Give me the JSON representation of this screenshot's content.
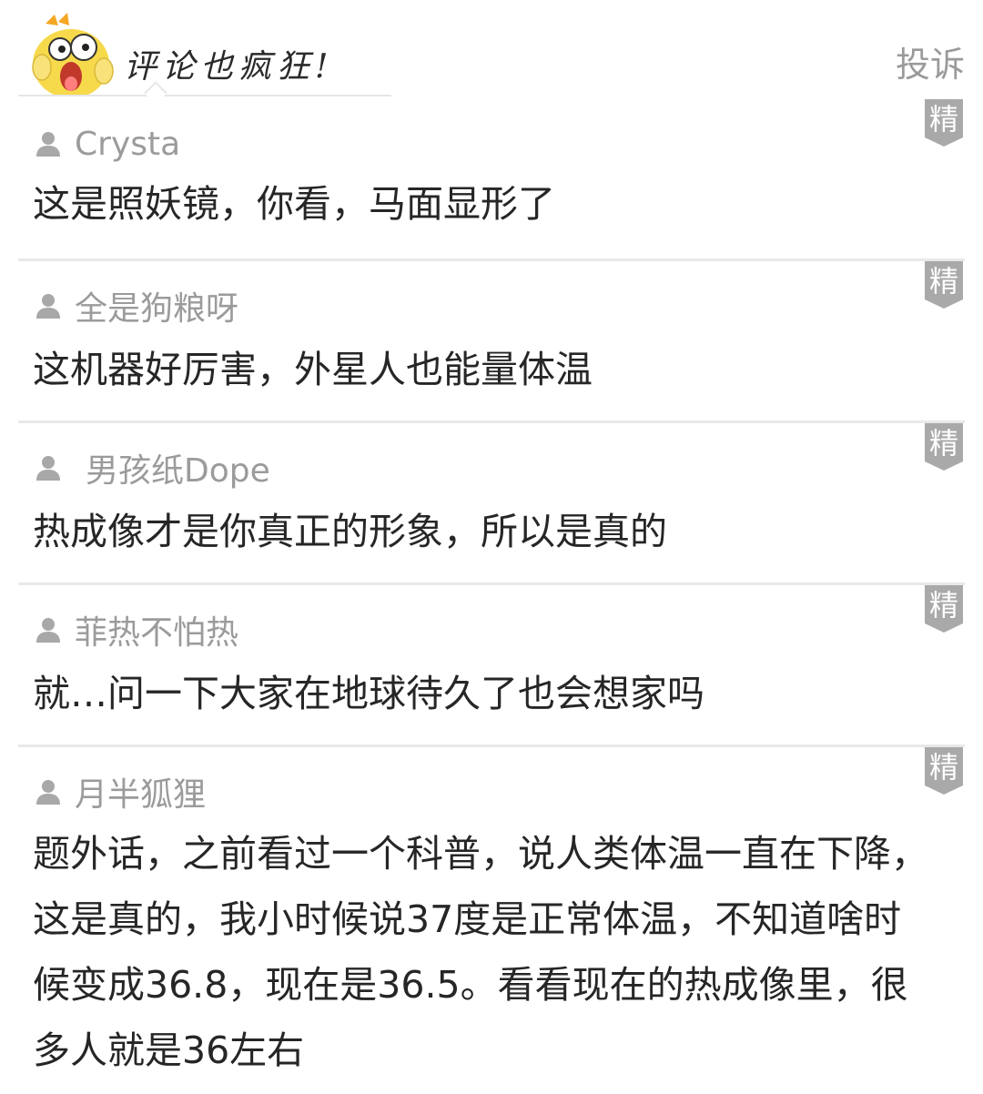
{
  "header": {
    "title": "评论也疯狂!",
    "report_label": "投诉"
  },
  "badge_label": "精",
  "comments": [
    {
      "username": "Crysta",
      "text": "这是照妖镜，你看，马面显形了"
    },
    {
      "username": "全是狗粮呀",
      "text": "这机器好厉害，外星人也能量体温"
    },
    {
      "username": "男孩纸Dope",
      "text": "热成像才是你真正的形象，所以是真的"
    },
    {
      "username": "菲热不怕热",
      "text": "就…问一下大家在地球待久了也会想家吗"
    },
    {
      "username": "月半狐狸",
      "text": "题外话，之前看过一个科普，说人类体温一直在下降，这是真的，我小时候说37度是正常体温，不知道啥时候变成36.8，现在是36.5。看看现在的热成像里，很多人就是36左右"
    }
  ],
  "colors": {
    "badge_bg": "#a9a9a9",
    "divider": "#e8e8e8",
    "muted_text": "#9b9b9b",
    "mascot_yellow": "#f7d94c"
  }
}
